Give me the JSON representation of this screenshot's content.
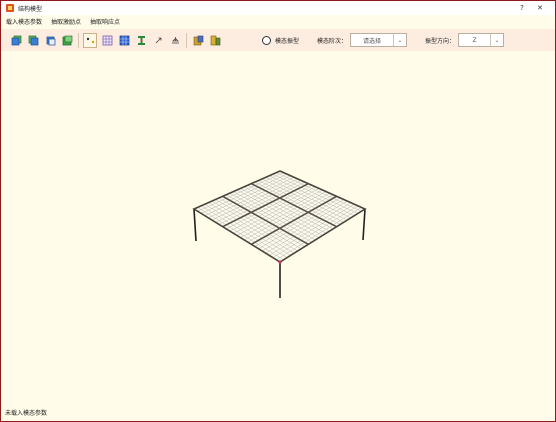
{
  "window": {
    "title": "结构模型"
  },
  "titlebar": {
    "help_label": "?",
    "close_label": "✕"
  },
  "menu": {
    "items": [
      {
        "label": "载入模态参数"
      },
      {
        "label": "抽取激励点"
      },
      {
        "label": "抽取响应点"
      }
    ]
  },
  "toolbar": {
    "radio_label": "模态振型",
    "mode_order_label": "模态阶次：",
    "mode_order_value": "请选择",
    "direction_label": "振型方向：",
    "direction_value": "Z"
  },
  "status": {
    "text": "未载入模态参数"
  },
  "colors": {
    "accent": "#e0521b",
    "background": "#fffde9",
    "toolbar": "#fdece0"
  }
}
